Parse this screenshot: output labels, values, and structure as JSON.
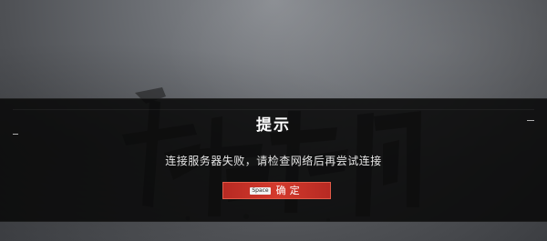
{
  "dialog": {
    "title": "提示",
    "message": "连接服务器失败，请检查网络后再尝试连接",
    "confirm_button": {
      "key_hint": "Space",
      "label": "确定"
    }
  },
  "colors": {
    "button_red": "#c8352a",
    "overlay": "#080808",
    "background": "#5a5c60"
  },
  "icons": {
    "background_art": "brush-calligraphy-icon"
  }
}
